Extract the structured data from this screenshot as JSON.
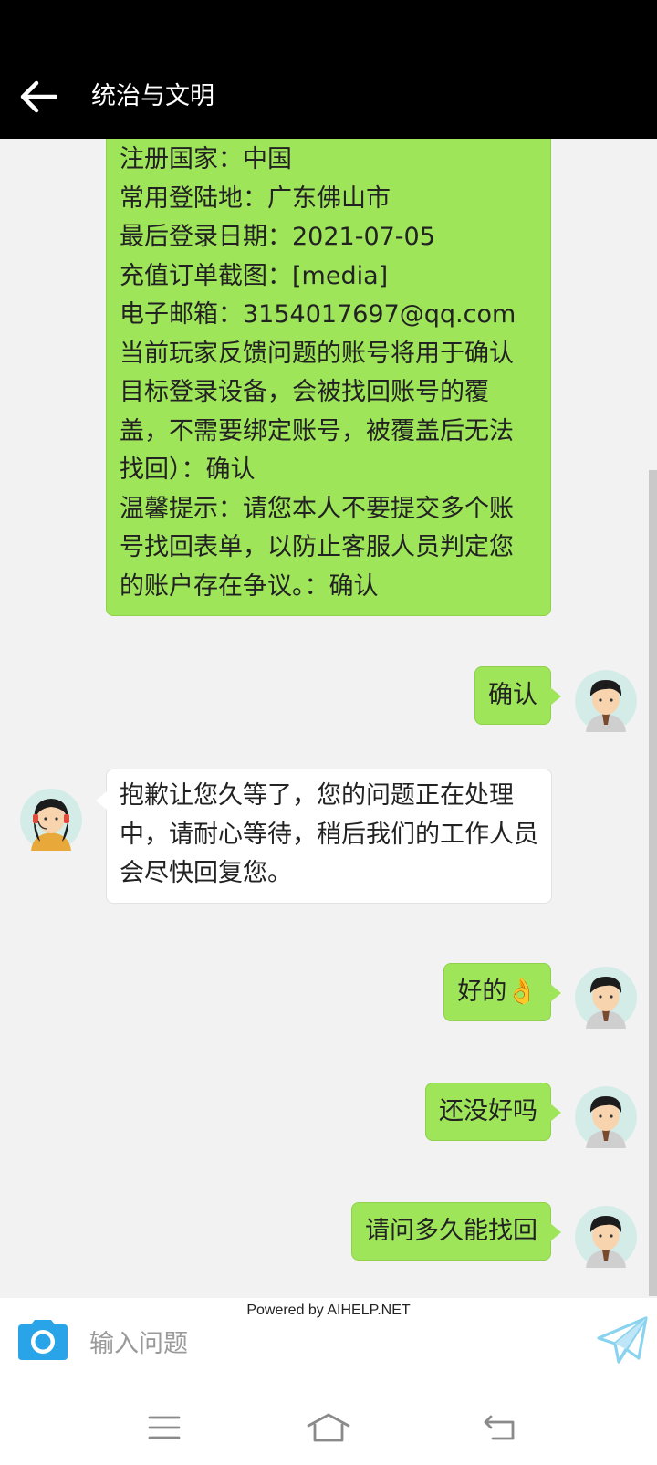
{
  "header": {
    "title": "统治与文明",
    "back_icon": "arrow-left-icon"
  },
  "messages": [
    {
      "sender": "user",
      "lines": [
        "注册国家：中国",
        "常用登陆地：广东佛山市",
        "最后登录日期：2021-07-05",
        "充值订单截图：[media]",
        "电子邮箱：3154017697@qq.com"
      ],
      "paragraphs": [
        "当前玩家反馈问题的账号将用于确认目标登录设备，会被找回账号的覆盖，不需要绑定账号，被覆盖后无法找回）：确认",
        "温馨提示：请您本人不要提交多个账号找回表单，以防止客服人员判定您的账户存在争议。：确认"
      ]
    },
    {
      "sender": "user",
      "text": "确认"
    },
    {
      "sender": "agent",
      "text": "抱歉让您久等了，您的问题正在处理中，请耐心等待，稍后我们的工作人员会尽快回复您。"
    },
    {
      "sender": "user",
      "text": "好的👌"
    },
    {
      "sender": "user",
      "text": "还没好吗"
    },
    {
      "sender": "user",
      "text": "请问多久能找回"
    }
  ],
  "footer": {
    "powered_by": "Powered by AIHELP.NET",
    "input_placeholder": "输入问题",
    "camera_icon": "camera-icon",
    "send_icon": "send-icon"
  },
  "navbar": {
    "menu_icon": "menu-icon",
    "home_icon": "home-icon",
    "back_icon": "back-icon"
  },
  "colors": {
    "topbar": "#000000",
    "chat_background": "#f2f2f2",
    "user_bubble": "#9fe55a",
    "agent_bubble": "#ffffff",
    "camera_icon": "#2aa4e8",
    "send_icon": "#8ad3ef"
  }
}
